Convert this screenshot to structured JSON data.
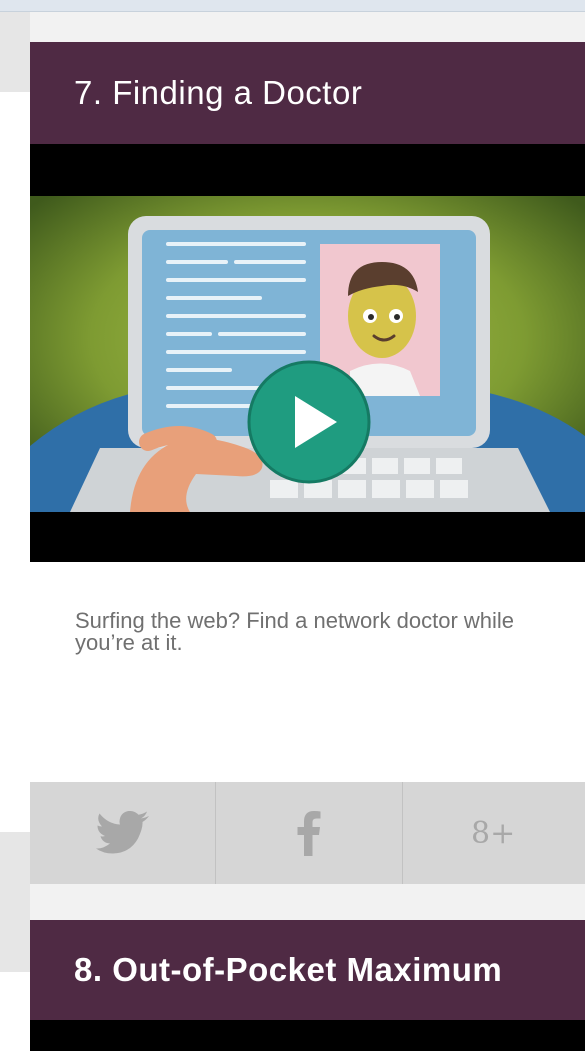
{
  "cards": [
    {
      "title": "7. Finding a Doctor",
      "description": "Surfing the web? Find a network doctor while you’re at it.",
      "video": {
        "play_icon": "play-icon"
      },
      "share": [
        {
          "network": "twitter",
          "icon": "twitter-icon"
        },
        {
          "network": "facebook",
          "icon": "facebook-icon"
        },
        {
          "network": "google-plus",
          "icon": "google-plus-icon",
          "glyph": "8+"
        }
      ]
    },
    {
      "title": "8. Out-of-Pocket Maximum"
    }
  ],
  "colors": {
    "header_bg": "#4f2a44",
    "play_button": "#1f9c80",
    "share_bar": "#d6d6d6",
    "share_icon": "#a8a8a8",
    "description_text": "#707070"
  }
}
